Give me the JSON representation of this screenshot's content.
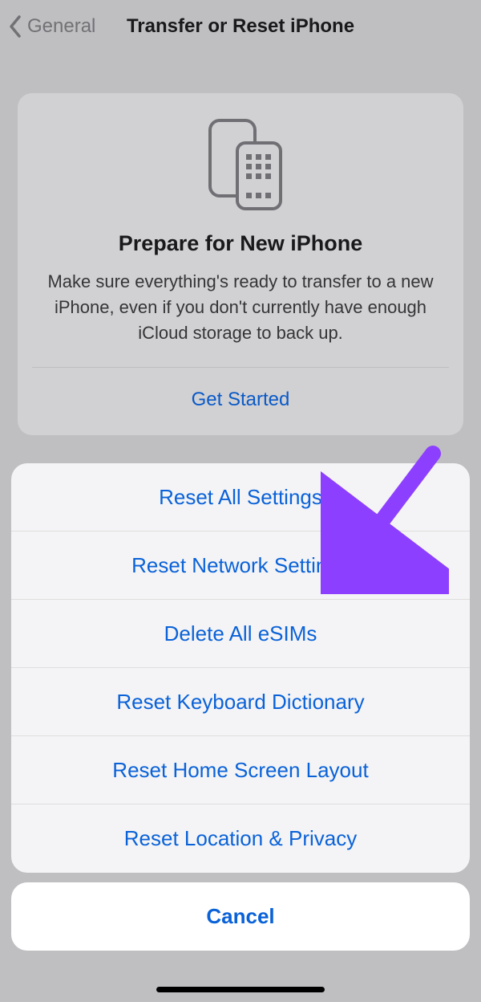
{
  "nav": {
    "back_label": "General",
    "title": "Transfer or Reset iPhone"
  },
  "card": {
    "heading": "Prepare for New iPhone",
    "body": "Make sure everything's ready to transfer to a new iPhone, even if you don't currently have enough iCloud storage to back up.",
    "cta": "Get Started"
  },
  "sheet": {
    "options": [
      "Reset All Settings",
      "Reset Network Settings",
      "Delete All eSIMs",
      "Reset Keyboard Dictionary",
      "Reset Home Screen Layout",
      "Reset Location & Privacy"
    ],
    "cancel": "Cancel"
  },
  "colors": {
    "link": "#0a62d8",
    "arrow": "#8d3fff"
  }
}
